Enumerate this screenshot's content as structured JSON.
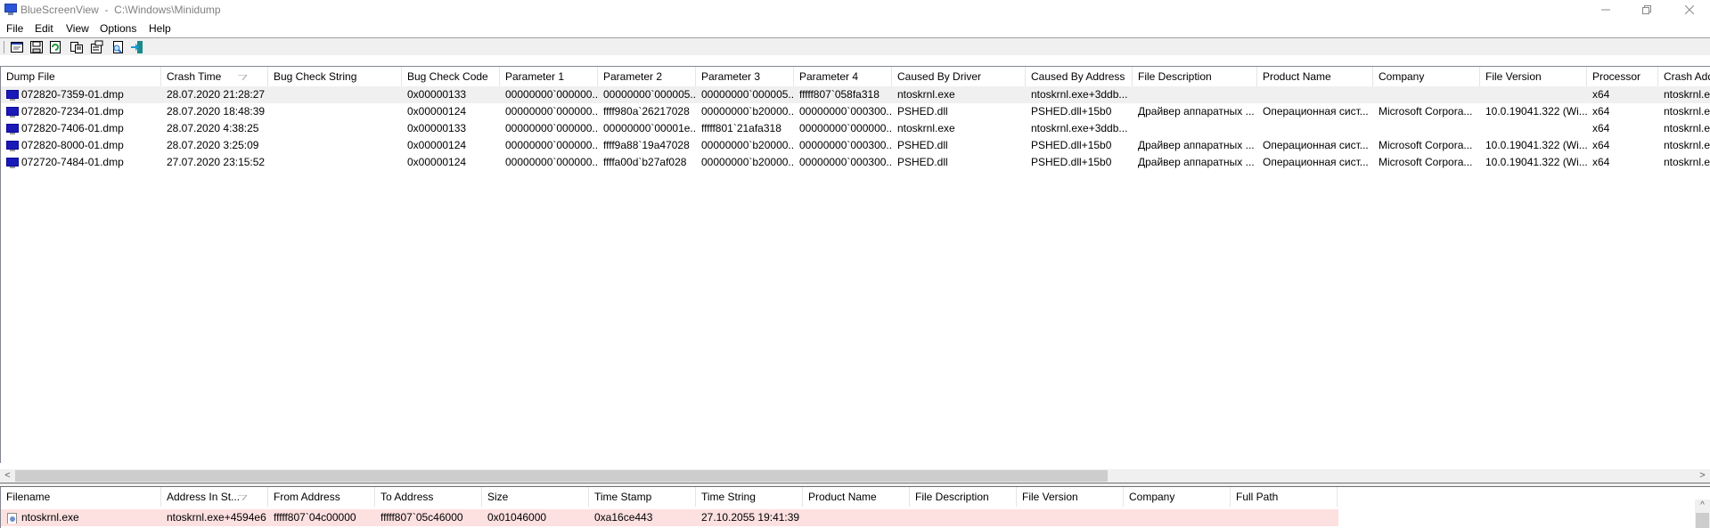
{
  "window": {
    "app_name": "BlueScreenView",
    "title": "BlueScreenView  -  C:\\Windows\\Minidump",
    "controls": [
      "minimize",
      "restore",
      "close"
    ]
  },
  "menu": [
    "File",
    "Edit",
    "View",
    "Options",
    "Help"
  ],
  "toolbar": {
    "buttons": [
      {
        "name": "advanced-options",
        "icon": "window-icon"
      },
      {
        "name": "save",
        "icon": "floppy-disk-icon"
      },
      {
        "name": "refresh",
        "icon": "refresh-icon"
      },
      {
        "name": "copy",
        "icon": "copy-icon"
      },
      {
        "name": "properties",
        "icon": "properties-icon"
      },
      {
        "name": "find",
        "icon": "find-icon"
      },
      {
        "name": "exit",
        "icon": "exit-icon"
      }
    ]
  },
  "crash_list": {
    "sort_column": "Crash Time",
    "columns": [
      "Dump File",
      "Crash Time",
      "Bug Check String",
      "Bug Check Code",
      "Parameter 1",
      "Parameter 2",
      "Parameter 3",
      "Parameter 4",
      "Caused By Driver",
      "Caused By Address",
      "File Description",
      "Product Name",
      "Company",
      "File Version",
      "Processor",
      "Crash Add"
    ],
    "rows": [
      [
        "072820-7359-01.dmp",
        "28.07.2020 21:28:27",
        "",
        "0x00000133",
        "00000000`000000...",
        "00000000`000005...",
        "00000000`000005...",
        "fffff807`058fa318",
        "ntoskrnl.exe",
        "ntoskrnl.exe+3ddb...",
        "",
        "",
        "",
        "",
        "x64",
        "ntoskrnl.e"
      ],
      [
        "072820-7234-01.dmp",
        "28.07.2020 18:48:39",
        "",
        "0x00000124",
        "00000000`000000...",
        "ffff980a`26217028",
        "00000000`b20000...",
        "00000000`000300...",
        "PSHED.dll",
        "PSHED.dll+15b0",
        "Драйвер аппаратных ...",
        "Операционная сист...",
        "Microsoft Corpora...",
        "10.0.19041.322 (Wi...",
        "x64",
        "ntoskrnl.e"
      ],
      [
        "072820-7406-01.dmp",
        "28.07.2020 4:38:25",
        "",
        "0x00000133",
        "00000000`000000...",
        "00000000`00001e...",
        "fffff801`21afa318",
        "00000000`000000...",
        "ntoskrnl.exe",
        "ntoskrnl.exe+3ddb...",
        "",
        "",
        "",
        "",
        "x64",
        "ntoskrnl.e"
      ],
      [
        "072820-8000-01.dmp",
        "28.07.2020 3:25:09",
        "",
        "0x00000124",
        "00000000`000000...",
        "ffff9a88`19a47028",
        "00000000`b20000...",
        "00000000`000300...",
        "PSHED.dll",
        "PSHED.dll+15b0",
        "Драйвер аппаратных ...",
        "Операционная сист...",
        "Microsoft Corpora...",
        "10.0.19041.322 (Wi...",
        "x64",
        "ntoskrnl.e"
      ],
      [
        "072720-7484-01.dmp",
        "27.07.2020 23:15:52",
        "",
        "0x00000124",
        "00000000`000000...",
        "ffffa00d`b27af028",
        "00000000`b20000...",
        "00000000`000300...",
        "PSHED.dll",
        "PSHED.dll+15b0",
        "Драйвер аппаратных ...",
        "Операционная сист...",
        "Microsoft Corpora...",
        "10.0.19041.322 (Wi...",
        "x64",
        "ntoskrnl.e"
      ]
    ],
    "selected_row": 0
  },
  "driver_list": {
    "sort_column": "Address In St...",
    "columns": [
      "Filename",
      "Address In St...",
      "From Address",
      "To Address",
      "Size",
      "Time Stamp",
      "Time String",
      "Product Name",
      "File Description",
      "File Version",
      "Company",
      "Full Path"
    ],
    "rows": [
      [
        "ntoskrnl.exe",
        "ntoskrnl.exe+4594e6",
        "fffff807`04c00000",
        "fffff807`05c46000",
        "0x01046000",
        "0xa16ce443",
        "27.10.2055 19:41:39",
        "",
        "",
        "",
        "",
        ""
      ]
    ],
    "highlight_color": "#fde0e0"
  },
  "scrollbars": {
    "left_arrow": "<",
    "right_arrow": ">",
    "up_arrow": "^"
  }
}
